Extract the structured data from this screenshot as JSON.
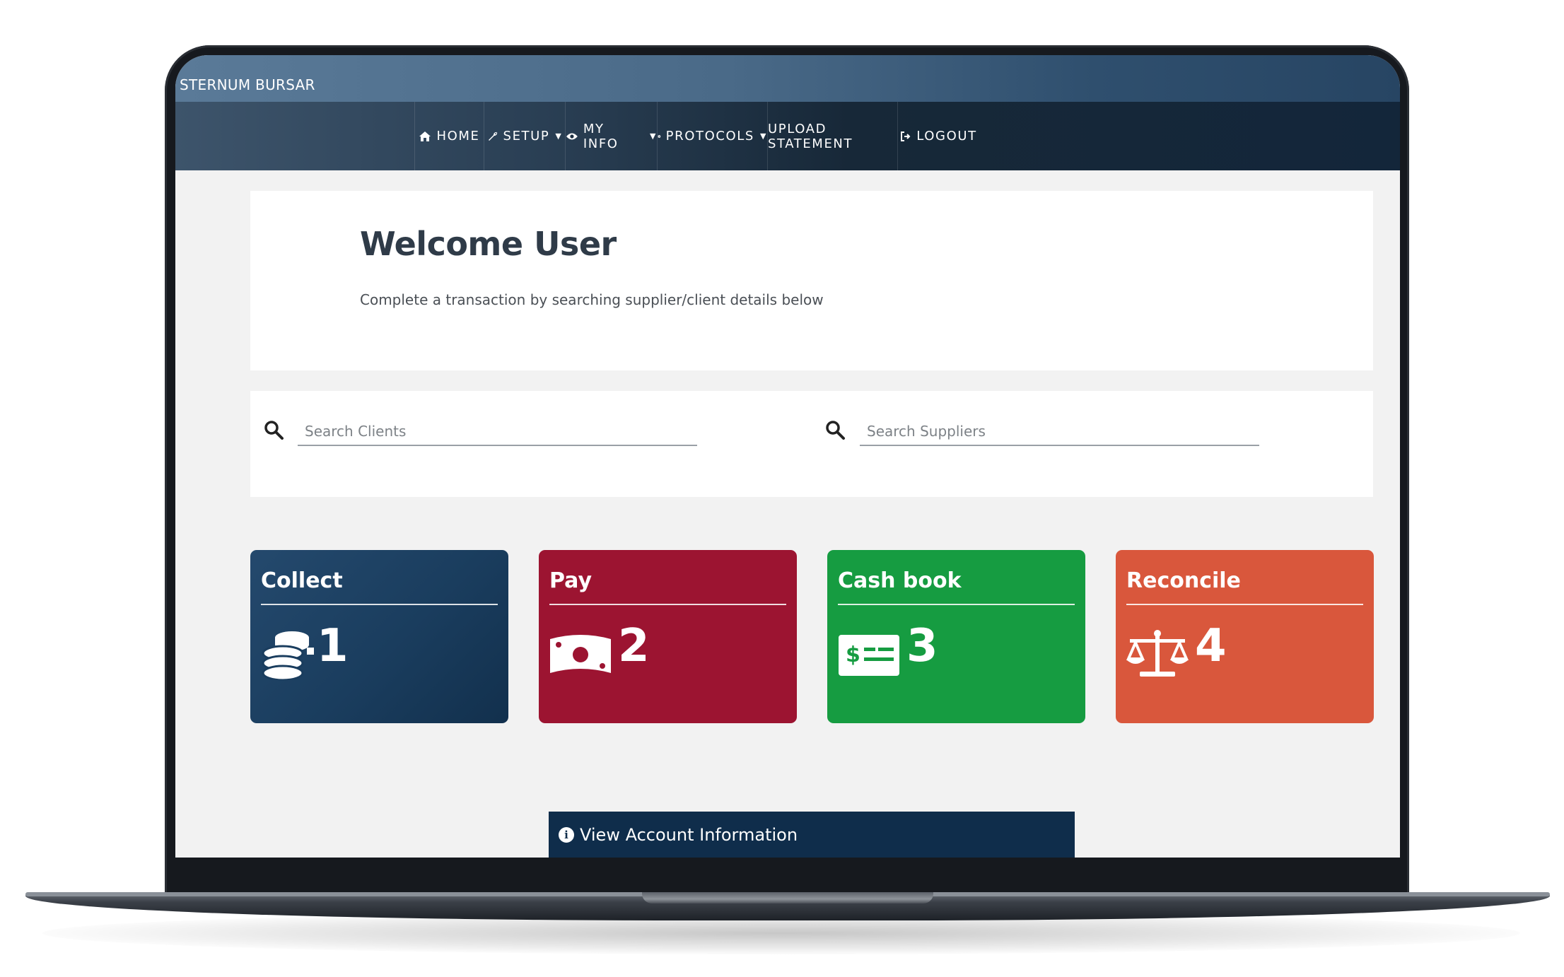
{
  "app": {
    "brand": "STERNUM BURSAR"
  },
  "nav": {
    "items": [
      {
        "label": "HOME",
        "icon": "home-icon",
        "dropdown": false
      },
      {
        "label": "SETUP",
        "icon": "wrench-icon",
        "dropdown": true
      },
      {
        "label": "MY INFO",
        "icon": "eye-icon",
        "dropdown": true
      },
      {
        "label": "PROTOCOLS",
        "icon": "gear-icon",
        "dropdown": true
      },
      {
        "label": "UPLOAD STATEMENT",
        "icon": "",
        "dropdown": false
      },
      {
        "label": "LOGOUT",
        "icon": "logout-icon",
        "dropdown": false
      }
    ]
  },
  "welcome": {
    "title": "Welcome User",
    "subtitle": "Complete a transaction by searching supplier/client details below"
  },
  "search": {
    "clients_placeholder": "Search Clients",
    "suppliers_placeholder": "Search Suppliers"
  },
  "tiles": [
    {
      "title": "Collect",
      "count": "1",
      "icon": "coins-icon",
      "color": "#1a3d5e"
    },
    {
      "title": "Pay",
      "count": "2",
      "icon": "money-bill-icon",
      "color": "#9c1431"
    },
    {
      "title": "Cash book",
      "count": "3",
      "icon": "cheque-icon",
      "color": "#169c41"
    },
    {
      "title": "Reconcile",
      "count": "4",
      "icon": "balance-scale-icon",
      "color": "#d9573c"
    }
  ],
  "account_button": {
    "label": "View Account Information",
    "icon": "info-circle-icon"
  },
  "theme": {
    "nav_bg": "#13263a",
    "topbar_bg": "#4a6a88",
    "account_bg": "#0f2d4b"
  }
}
